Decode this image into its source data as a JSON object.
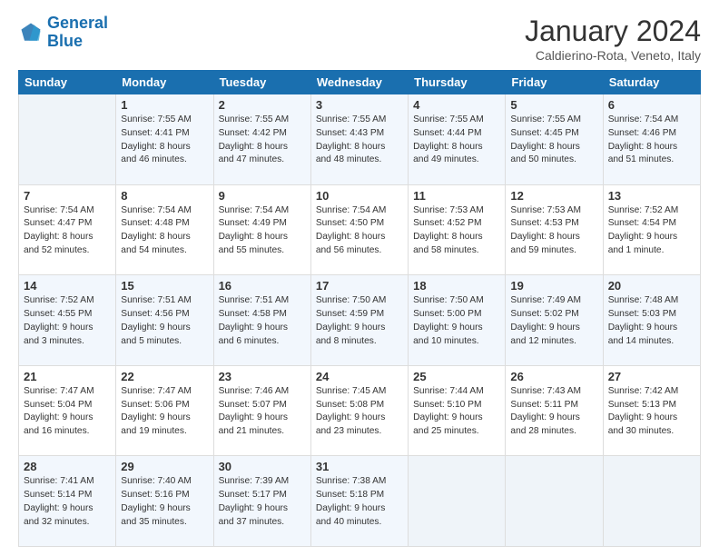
{
  "header": {
    "logo_line1": "General",
    "logo_line2": "Blue",
    "month_title": "January 2024",
    "location": "Caldierino-Rota, Veneto, Italy"
  },
  "weekdays": [
    "Sunday",
    "Monday",
    "Tuesday",
    "Wednesday",
    "Thursday",
    "Friday",
    "Saturday"
  ],
  "weeks": [
    [
      {
        "day": "",
        "content": ""
      },
      {
        "day": "1",
        "content": "Sunrise: 7:55 AM\nSunset: 4:41 PM\nDaylight: 8 hours\nand 46 minutes."
      },
      {
        "day": "2",
        "content": "Sunrise: 7:55 AM\nSunset: 4:42 PM\nDaylight: 8 hours\nand 47 minutes."
      },
      {
        "day": "3",
        "content": "Sunrise: 7:55 AM\nSunset: 4:43 PM\nDaylight: 8 hours\nand 48 minutes."
      },
      {
        "day": "4",
        "content": "Sunrise: 7:55 AM\nSunset: 4:44 PM\nDaylight: 8 hours\nand 49 minutes."
      },
      {
        "day": "5",
        "content": "Sunrise: 7:55 AM\nSunset: 4:45 PM\nDaylight: 8 hours\nand 50 minutes."
      },
      {
        "day": "6",
        "content": "Sunrise: 7:54 AM\nSunset: 4:46 PM\nDaylight: 8 hours\nand 51 minutes."
      }
    ],
    [
      {
        "day": "7",
        "content": "Sunrise: 7:54 AM\nSunset: 4:47 PM\nDaylight: 8 hours\nand 52 minutes."
      },
      {
        "day": "8",
        "content": "Sunrise: 7:54 AM\nSunset: 4:48 PM\nDaylight: 8 hours\nand 54 minutes."
      },
      {
        "day": "9",
        "content": "Sunrise: 7:54 AM\nSunset: 4:49 PM\nDaylight: 8 hours\nand 55 minutes."
      },
      {
        "day": "10",
        "content": "Sunrise: 7:54 AM\nSunset: 4:50 PM\nDaylight: 8 hours\nand 56 minutes."
      },
      {
        "day": "11",
        "content": "Sunrise: 7:53 AM\nSunset: 4:52 PM\nDaylight: 8 hours\nand 58 minutes."
      },
      {
        "day": "12",
        "content": "Sunrise: 7:53 AM\nSunset: 4:53 PM\nDaylight: 8 hours\nand 59 minutes."
      },
      {
        "day": "13",
        "content": "Sunrise: 7:52 AM\nSunset: 4:54 PM\nDaylight: 9 hours\nand 1 minute."
      }
    ],
    [
      {
        "day": "14",
        "content": "Sunrise: 7:52 AM\nSunset: 4:55 PM\nDaylight: 9 hours\nand 3 minutes."
      },
      {
        "day": "15",
        "content": "Sunrise: 7:51 AM\nSunset: 4:56 PM\nDaylight: 9 hours\nand 5 minutes."
      },
      {
        "day": "16",
        "content": "Sunrise: 7:51 AM\nSunset: 4:58 PM\nDaylight: 9 hours\nand 6 minutes."
      },
      {
        "day": "17",
        "content": "Sunrise: 7:50 AM\nSunset: 4:59 PM\nDaylight: 9 hours\nand 8 minutes."
      },
      {
        "day": "18",
        "content": "Sunrise: 7:50 AM\nSunset: 5:00 PM\nDaylight: 9 hours\nand 10 minutes."
      },
      {
        "day": "19",
        "content": "Sunrise: 7:49 AM\nSunset: 5:02 PM\nDaylight: 9 hours\nand 12 minutes."
      },
      {
        "day": "20",
        "content": "Sunrise: 7:48 AM\nSunset: 5:03 PM\nDaylight: 9 hours\nand 14 minutes."
      }
    ],
    [
      {
        "day": "21",
        "content": "Sunrise: 7:47 AM\nSunset: 5:04 PM\nDaylight: 9 hours\nand 16 minutes."
      },
      {
        "day": "22",
        "content": "Sunrise: 7:47 AM\nSunset: 5:06 PM\nDaylight: 9 hours\nand 19 minutes."
      },
      {
        "day": "23",
        "content": "Sunrise: 7:46 AM\nSunset: 5:07 PM\nDaylight: 9 hours\nand 21 minutes."
      },
      {
        "day": "24",
        "content": "Sunrise: 7:45 AM\nSunset: 5:08 PM\nDaylight: 9 hours\nand 23 minutes."
      },
      {
        "day": "25",
        "content": "Sunrise: 7:44 AM\nSunset: 5:10 PM\nDaylight: 9 hours\nand 25 minutes."
      },
      {
        "day": "26",
        "content": "Sunrise: 7:43 AM\nSunset: 5:11 PM\nDaylight: 9 hours\nand 28 minutes."
      },
      {
        "day": "27",
        "content": "Sunrise: 7:42 AM\nSunset: 5:13 PM\nDaylight: 9 hours\nand 30 minutes."
      }
    ],
    [
      {
        "day": "28",
        "content": "Sunrise: 7:41 AM\nSunset: 5:14 PM\nDaylight: 9 hours\nand 32 minutes."
      },
      {
        "day": "29",
        "content": "Sunrise: 7:40 AM\nSunset: 5:16 PM\nDaylight: 9 hours\nand 35 minutes."
      },
      {
        "day": "30",
        "content": "Sunrise: 7:39 AM\nSunset: 5:17 PM\nDaylight: 9 hours\nand 37 minutes."
      },
      {
        "day": "31",
        "content": "Sunrise: 7:38 AM\nSunset: 5:18 PM\nDaylight: 9 hours\nand 40 minutes."
      },
      {
        "day": "",
        "content": ""
      },
      {
        "day": "",
        "content": ""
      },
      {
        "day": "",
        "content": ""
      }
    ]
  ]
}
